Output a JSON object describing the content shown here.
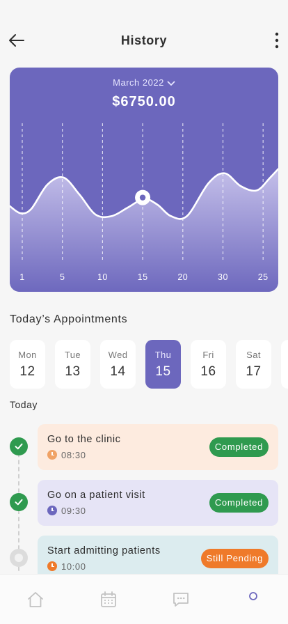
{
  "header": {
    "title": "History"
  },
  "summary": {
    "month": "March 2022",
    "amount": "$6750.00",
    "chart_data": {
      "type": "area",
      "x_tick_labels": [
        "1",
        "5",
        "10",
        "15",
        "20",
        "30",
        "25"
      ],
      "selected_tick": "15",
      "grid": "vertical dashed",
      "curve_points": [
        {
          "x": 0,
          "y": 0.42
        },
        {
          "x": 0.04,
          "y": 0.37
        },
        {
          "x": 0.08,
          "y": 0.4
        },
        {
          "x": 0.14,
          "y": 0.57
        },
        {
          "x": 0.2,
          "y": 0.62
        },
        {
          "x": 0.26,
          "y": 0.5
        },
        {
          "x": 0.32,
          "y": 0.36
        },
        {
          "x": 0.38,
          "y": 0.35
        },
        {
          "x": 0.44,
          "y": 0.41
        },
        {
          "x": 0.5,
          "y": 0.47
        },
        {
          "x": 0.55,
          "y": 0.43
        },
        {
          "x": 0.6,
          "y": 0.35
        },
        {
          "x": 0.66,
          "y": 0.35
        },
        {
          "x": 0.74,
          "y": 0.58
        },
        {
          "x": 0.8,
          "y": 0.65
        },
        {
          "x": 0.86,
          "y": 0.56
        },
        {
          "x": 0.92,
          "y": 0.53
        },
        {
          "x": 0.97,
          "y": 0.62
        },
        {
          "x": 1,
          "y": 0.68
        }
      ],
      "highlight": {
        "x": 0.495,
        "y": 0.47
      },
      "colors": {
        "background": "#6c67bd",
        "line": "#ffffff",
        "fill_top": "#c9c4ec",
        "fill_bottom": "#6c67bd"
      }
    }
  },
  "appointments": {
    "title": "Today’s Appointments",
    "days": [
      {
        "name": "Mon",
        "num": "12",
        "active": false
      },
      {
        "name": "Tue",
        "num": "13",
        "active": false
      },
      {
        "name": "Wed",
        "num": "14",
        "active": false
      },
      {
        "name": "Thu",
        "num": "15",
        "active": true
      },
      {
        "name": "Fri",
        "num": "16",
        "active": false
      },
      {
        "name": "Sat",
        "num": "17",
        "active": false
      },
      {
        "name": "",
        "num": "",
        "active": false
      }
    ],
    "today_label": "Today",
    "items": [
      {
        "title": "Go to the clinic",
        "time": "08:30",
        "status": "Completed",
        "bg": "#fdebdf",
        "clock": "#f0a265",
        "badge": "#2f9a4f",
        "done": true
      },
      {
        "title": "Go on a patient visit",
        "time": "09:30",
        "status": "Completed",
        "bg": "#e6e4f6",
        "clock": "#6c67bd",
        "badge": "#2f9a4f",
        "done": true
      },
      {
        "title": "Start admitting patients",
        "time": "10:00",
        "status": "Still Pending",
        "bg": "#dcecef",
        "clock": "#ef7a2a",
        "badge": "#ef7a2a",
        "done": false
      }
    ]
  },
  "nav": {
    "items": [
      {
        "icon": "home-icon",
        "active": false
      },
      {
        "icon": "calendar-icon",
        "active": false
      },
      {
        "icon": "chat-icon",
        "active": false
      },
      {
        "icon": "profile-icon",
        "active": true
      }
    ],
    "colors": {
      "inactive": "#c2c2c2",
      "active": "#6c67bd"
    }
  }
}
